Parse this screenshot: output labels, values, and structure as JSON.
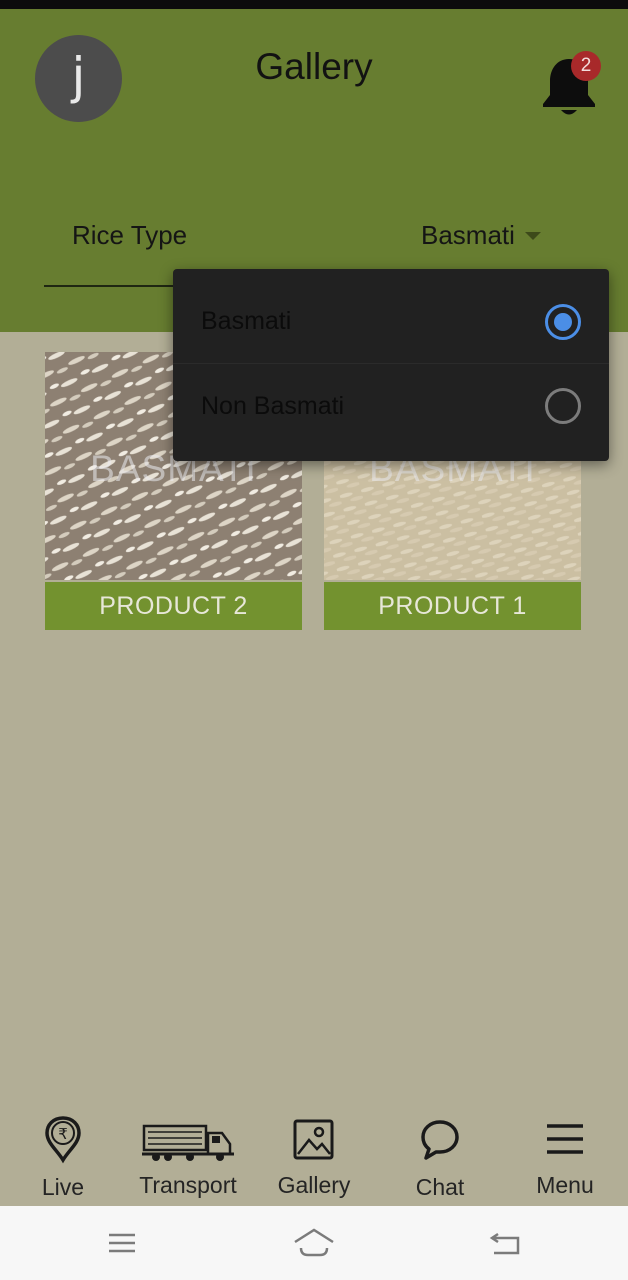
{
  "header": {
    "avatar_letter": "j",
    "title": "Gallery",
    "notification_count": "2",
    "icons": [
      "bell-icon"
    ]
  },
  "filter": {
    "label": "Rice Type",
    "selected_value": "Basmati"
  },
  "dropdown": {
    "options": [
      {
        "label": "Basmati",
        "selected": true
      },
      {
        "label": "Non Basmati",
        "selected": false
      }
    ]
  },
  "products": [
    {
      "label": "PRODUCT 2",
      "watermark": "BASMATI"
    },
    {
      "label": "PRODUCT 1",
      "watermark": "BASMATI"
    }
  ],
  "bottom_nav": [
    {
      "label": "Live",
      "icon": "rupee-pin-icon"
    },
    {
      "label": "Transport",
      "icon": "truck-icon"
    },
    {
      "label": "Gallery",
      "icon": "image-icon"
    },
    {
      "label": "Chat",
      "icon": "chat-bubble-icon"
    },
    {
      "label": "Menu",
      "icon": "hamburger-icon"
    }
  ],
  "system_nav": [
    "recents-icon",
    "home-icon",
    "back-icon"
  ],
  "colors": {
    "header": "#677d30",
    "page_background": "#b2ae96",
    "product_label": "#73922f",
    "badge": "#a8292a",
    "radio_selected": "#4b8ee6",
    "dropdown": "#212121"
  }
}
